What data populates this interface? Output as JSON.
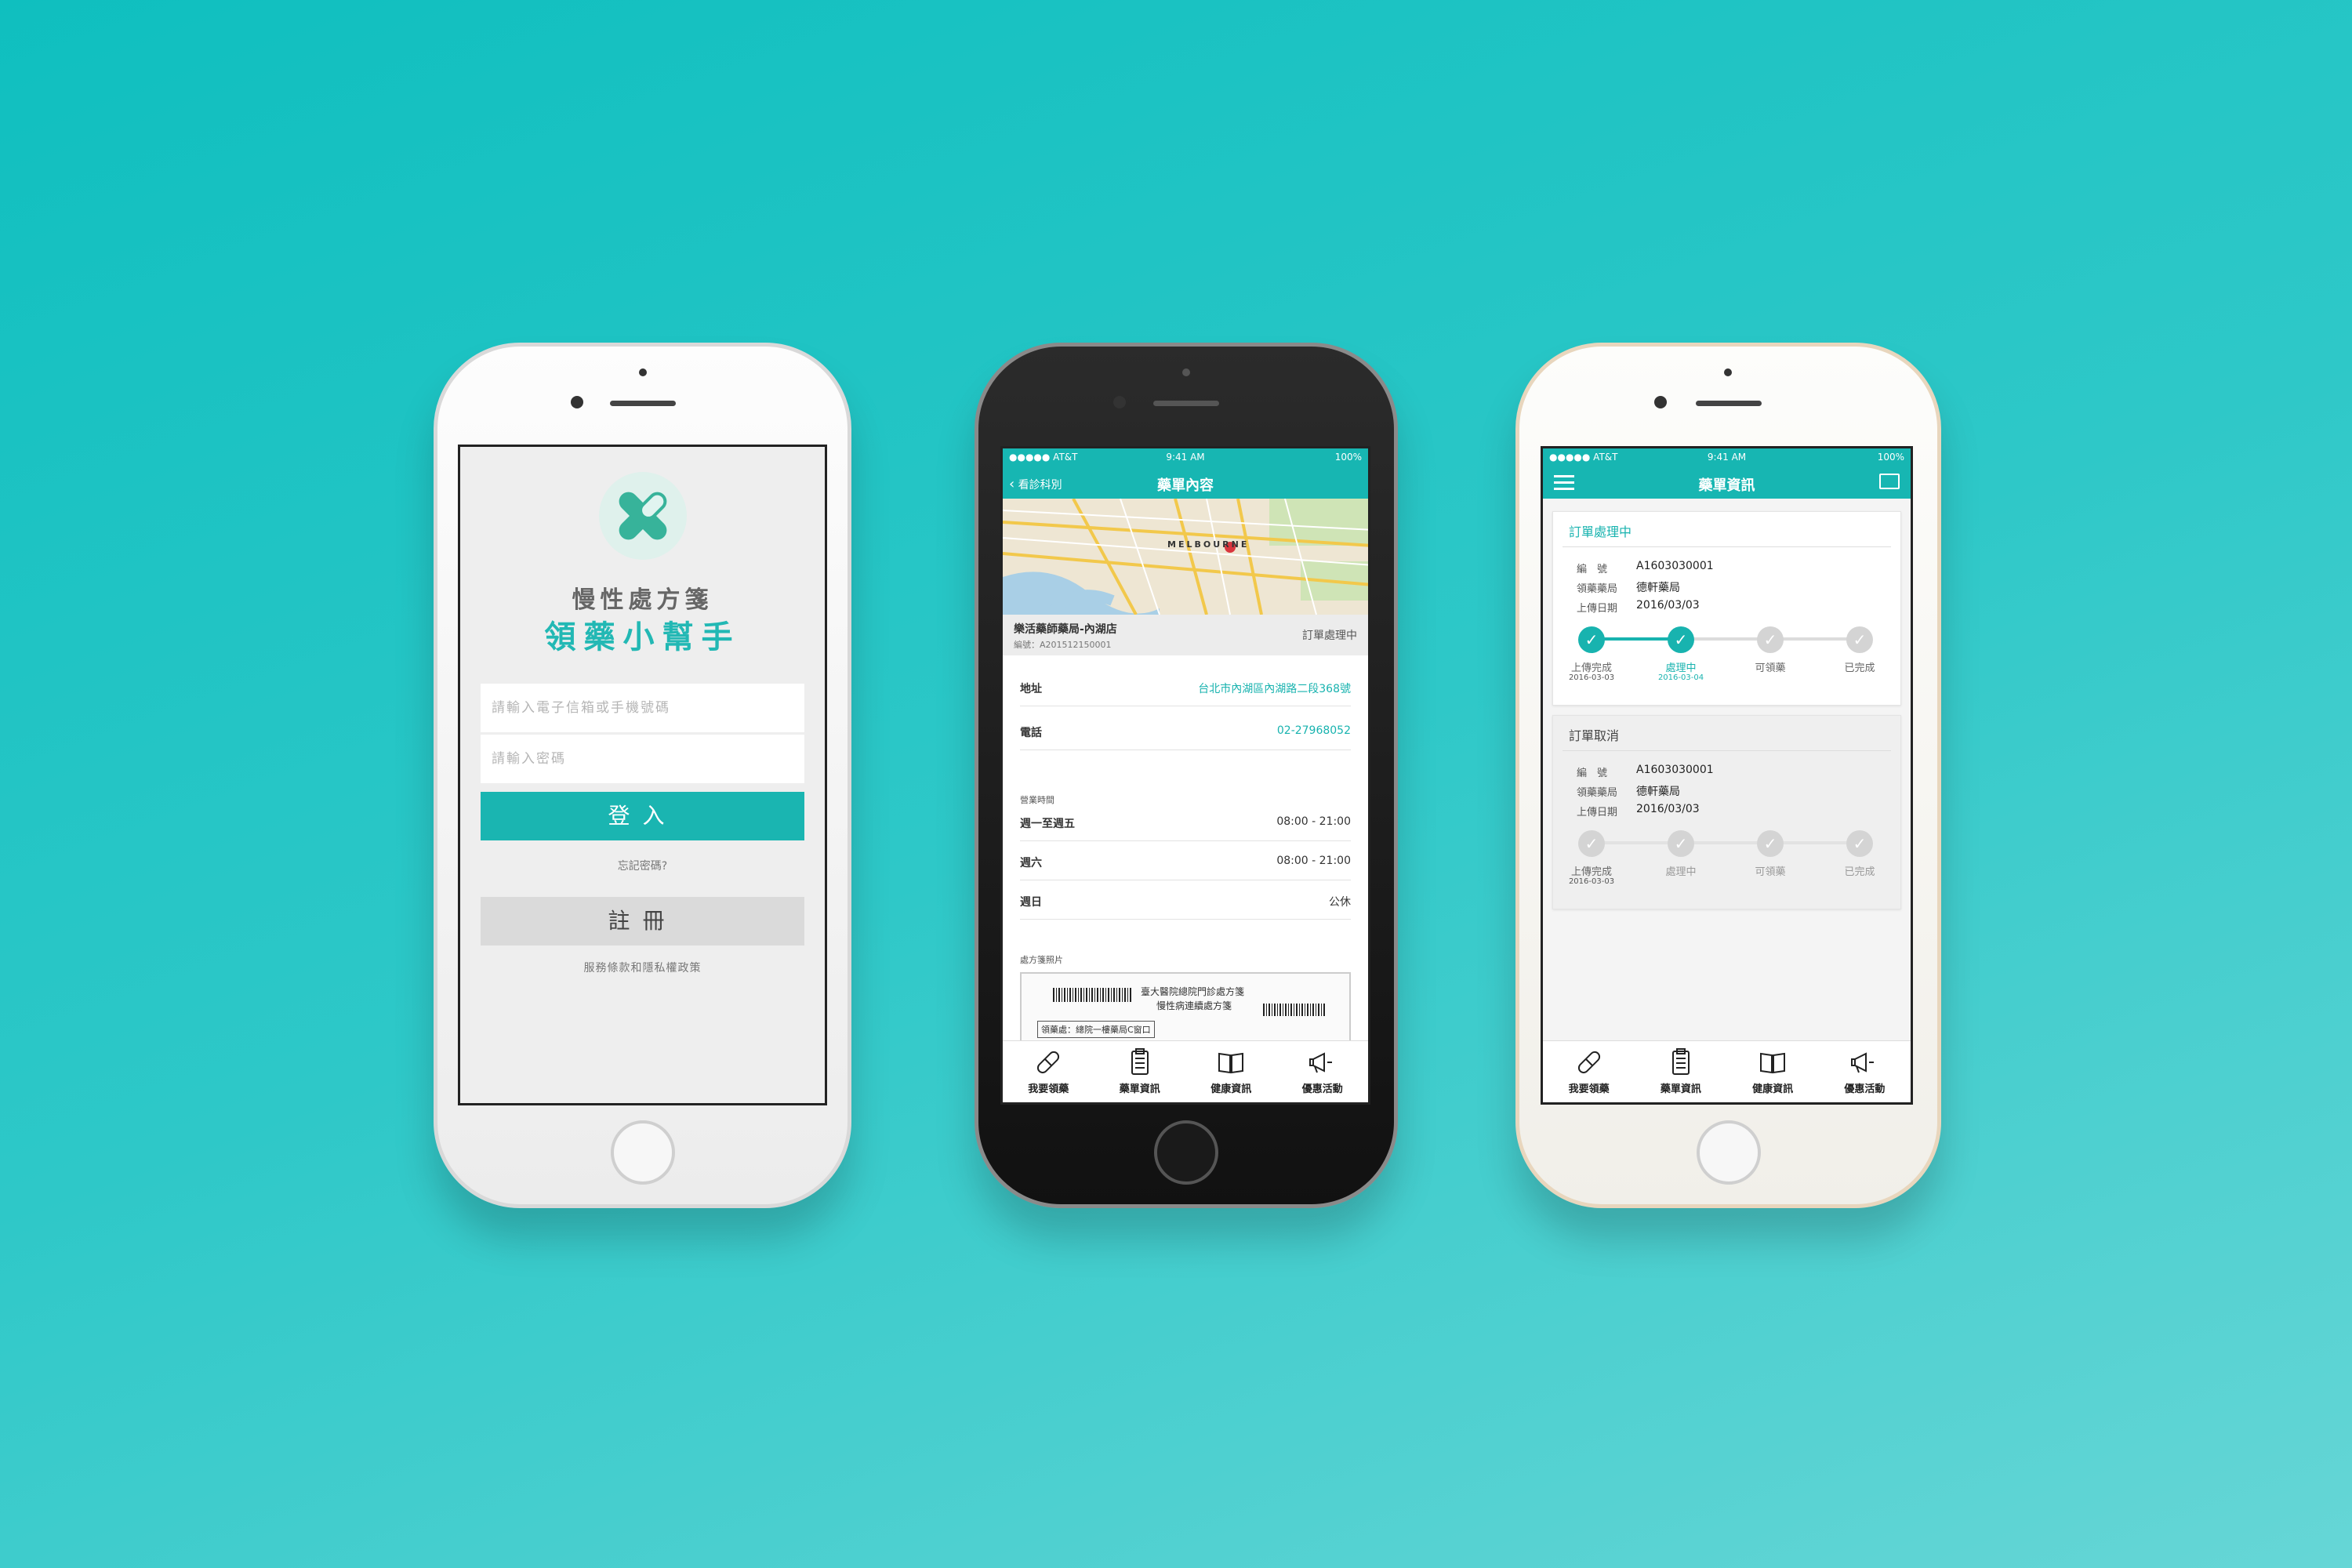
{
  "screen1": {
    "title_line1": "慢性處方箋",
    "title_line2": "領藥小幫手",
    "email_placeholder": "請輸入電子信箱或手機號碼",
    "password_placeholder": "請輸入密碼",
    "login_label": "登入",
    "forgot_label": "忘記密碼?",
    "register_label": "註冊",
    "terms_label": "服務條款和隱私權政策"
  },
  "status": {
    "carrier": "●●●●● AT&T",
    "time": "9:41 AM",
    "battery": "100%"
  },
  "screen2": {
    "back_label": "看診科別",
    "title": "藥單內容",
    "map_label": "MELBOURNE",
    "pharmacy_name": "樂活藥師藥局-內湖店",
    "order_no": "編號：A201512150001",
    "order_status": "訂單處理中",
    "address_label": "地址",
    "address_value": "台北市內湖區內湖路二段368號",
    "phone_label": "電話",
    "phone_value": "02-27968052",
    "hours_title": "營業時間",
    "hours": [
      {
        "day": "週一至週五",
        "time": "08:00 - 21:00"
      },
      {
        "day": "週六",
        "time": "08:00 - 21:00"
      },
      {
        "day": "週日",
        "time": "公休"
      }
    ],
    "photo_title": "處方箋照片",
    "presc_line1": "臺大醫院總院門診處方箋",
    "presc_line2": "慢性病連續處方箋",
    "presc_line3": "領藥處：總院一樓藥局C窗口"
  },
  "screen3": {
    "title": "藥單資訊",
    "order1": {
      "header": "訂單處理中",
      "no_label": "編　號",
      "no_value": "A1603030001",
      "pharm_label": "領藥藥局",
      "pharm_value": "德軒藥局",
      "date_label": "上傳日期",
      "date_value": "2016/03/03",
      "steps": [
        {
          "label": "上傳完成",
          "date": "2016-03-03"
        },
        {
          "label": "處理中",
          "date": "2016-03-04"
        },
        {
          "label": "可領藥",
          "date": ""
        },
        {
          "label": "已完成",
          "date": ""
        }
      ]
    },
    "order2": {
      "header": "訂單取消",
      "no_label": "編　號",
      "no_value": "A1603030001",
      "pharm_label": "領藥藥局",
      "pharm_value": "德軒藥局",
      "date_label": "上傳日期",
      "date_value": "2016/03/03",
      "steps": [
        {
          "label": "上傳完成",
          "date": "2016-03-03"
        },
        {
          "label": "處理中",
          "date": ""
        },
        {
          "label": "可領藥",
          "date": ""
        },
        {
          "label": "已完成",
          "date": ""
        }
      ]
    }
  },
  "tabs": [
    "我要領藥",
    "藥單資訊",
    "健康資訊",
    "優惠活動"
  ],
  "colors": {
    "accent": "#17b6b2",
    "background": "#22c4c4"
  }
}
